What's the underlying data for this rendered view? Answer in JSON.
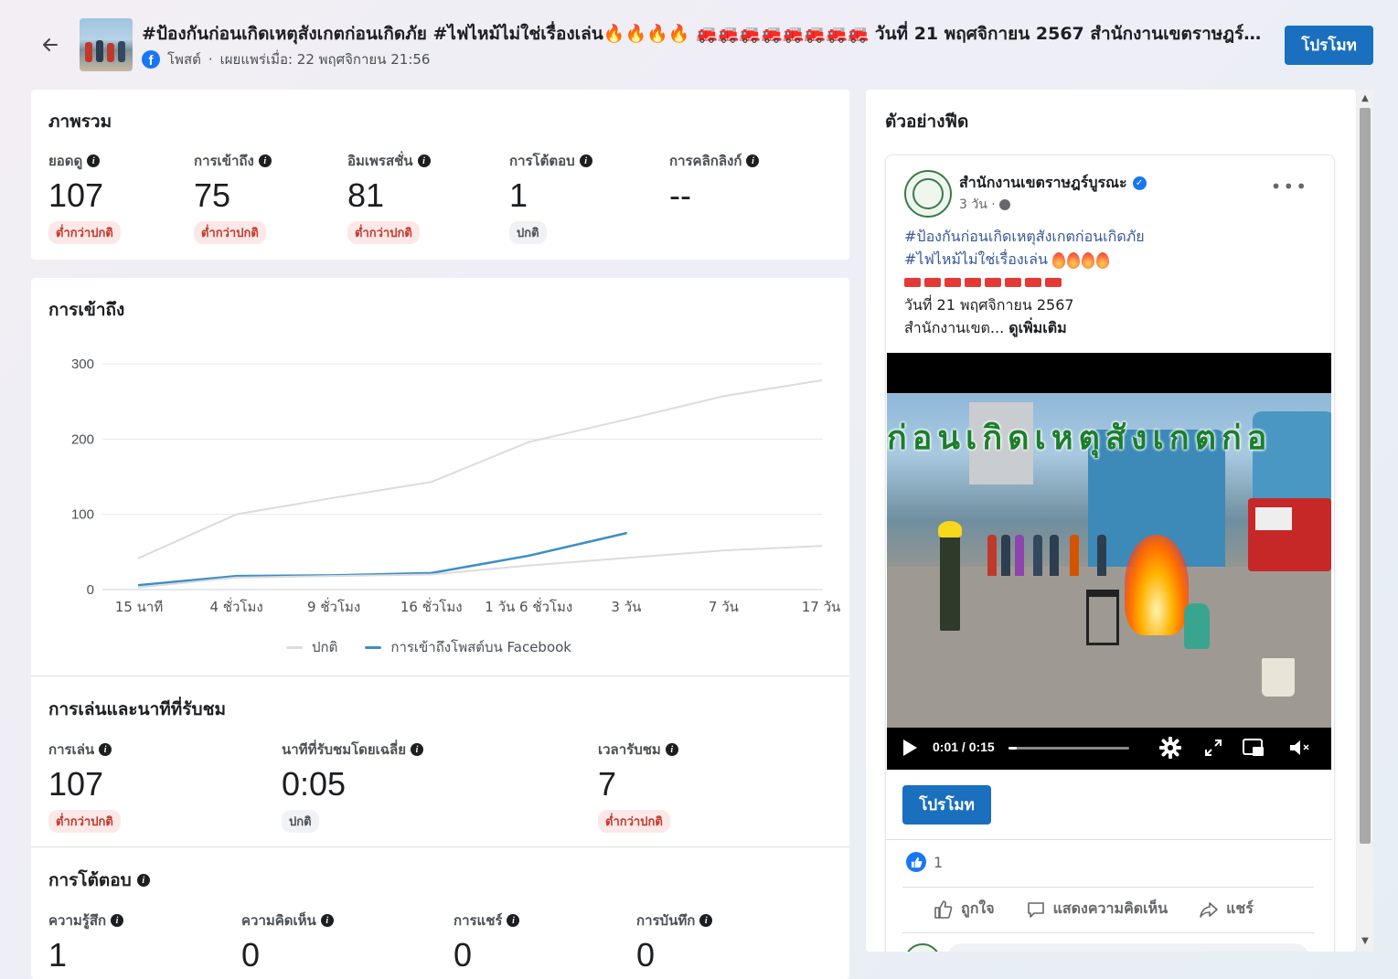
{
  "header": {
    "post_title": "#ป้องกันก่อนเกิดเหตุสังเกตก่อนเกิดภัย #ไฟไหม้ไม่ใช่เรื่องเล่น🔥🔥🔥🔥 🚒🚒🚒🚒🚒🚒🚒🚒 วันที่ 21 พฤศจิกายน 2567 สำนักงานเขตราษฎร์บูร...",
    "post_type": "โพสต์",
    "published": "เผยแพร่เมื่อ: 22 พฤศจิกายน 21:56",
    "promote_label": "โปรโมท"
  },
  "overview": {
    "title": "ภาพรวม",
    "metrics": [
      {
        "label": "ยอดดู",
        "value": "107",
        "status": "ต่ำกว่าปกติ"
      },
      {
        "label": "การเข้าถึง",
        "value": "75",
        "status": "ต่ำกว่าปกติ"
      },
      {
        "label": "อิมเพรสชั่น",
        "value": "81",
        "status": "ต่ำกว่าปกติ"
      },
      {
        "label": "การโต้ตอบ",
        "value": "1",
        "status": "ปกติ"
      },
      {
        "label": "การคลิกลิงก์",
        "value": "--",
        "status": ""
      }
    ]
  },
  "reach": {
    "title": "การเข้าถึง",
    "legend_normal": "ปกติ",
    "legend_post": "การเข้าถึงโพสต์บน Facebook"
  },
  "chart_data": {
    "type": "line",
    "title": "การเข้าถึง",
    "x": [
      "15 นาที",
      "4 ชั่วโมง",
      "9 ชั่วโมง",
      "16 ชั่วโมง",
      "1 วัน 6 ชั่วโมง",
      "3 วัน",
      "7 วัน",
      "17 วัน"
    ],
    "y_ticks": [
      0,
      100,
      200,
      300
    ],
    "ylim": [
      0,
      300
    ],
    "grid": true,
    "legend_position": "bottom",
    "series": [
      {
        "name": "ปกติ",
        "color": "#dcdcdc",
        "values": [
          42,
          100,
          122,
          143,
          196,
          226,
          257,
          278
        ]
      },
      {
        "name": "การเข้าถึงโพสต์บน Facebook",
        "color": "#3b8fc6",
        "values": [
          6,
          18,
          19,
          22,
          45,
          75
        ]
      },
      {
        "name": "ปกติ (ล่าง)",
        "color": "#dcdcdc",
        "values": [
          3,
          16,
          18,
          20,
          32,
          42,
          52,
          58
        ]
      }
    ]
  },
  "playback": {
    "title": "การเล่นและนาทีที่รับชม",
    "metrics": [
      {
        "label": "การเล่น",
        "value": "107",
        "status": "ต่ำกว่าปกติ"
      },
      {
        "label": "นาทีที่รับชมโดยเฉลี่ย",
        "value": "0:05",
        "status": "ปกติ"
      },
      {
        "label": "เวลารับชม",
        "value": "7",
        "status": "ต่ำกว่าปกติ"
      }
    ]
  },
  "engagement": {
    "title": "การโต้ตอบ",
    "metrics": [
      {
        "label": "ความรู้สึก",
        "value": "1"
      },
      {
        "label": "ความคิดเห็น",
        "value": "0"
      },
      {
        "label": "การแชร์",
        "value": "0"
      },
      {
        "label": "การบันทึก",
        "value": "0"
      }
    ]
  },
  "feed_preview": {
    "title": "ตัวอย่างฟีด",
    "page_name": "สำนักงานเขตราษฎร์บูรณะ",
    "time": "3 วัน ·",
    "hashtag1": "#ป้องกันก่อนเกิดเหตุสังเกตก่อนเกิดภัย",
    "hashtag2": "#ไฟไหม้ไม่ใช่เรื่องเล่น",
    "date_line": "วันที่ 21 พฤศจิกายน 2567",
    "office_line": "สำนักงานเขต...",
    "see_more": "ดูเพิ่มเติม",
    "video_overlay": "ก่อนเกิดเหตุสังเกตก่อ",
    "video_time": "0:01 / 0:15",
    "video_progress": 0.07,
    "promote_label": "โปรโมท",
    "reaction_count": "1",
    "like": "ถูกใจ",
    "comment": "แสดงความคิดเห็น",
    "share": "แชร์"
  }
}
